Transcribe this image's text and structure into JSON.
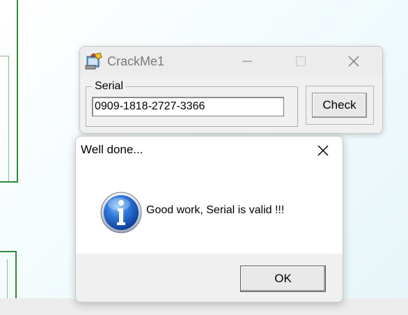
{
  "main_window": {
    "title": "CrackMe1",
    "caption_buttons": {
      "minimize": "minimize-icon",
      "maximize": "maximize-icon",
      "close": "close-icon"
    },
    "serial_group_label": "Serial",
    "serial_value": "0909-1818-2727-3366",
    "check_button_label": "Check"
  },
  "message_box": {
    "title": "Well done...",
    "message": "Good work, Serial is valid !!!",
    "ok_button_label": "OK",
    "icon": "info-icon"
  },
  "colors": {
    "background_line": "#2e8b3a",
    "info_icon_blue": "#1e5fc0"
  }
}
